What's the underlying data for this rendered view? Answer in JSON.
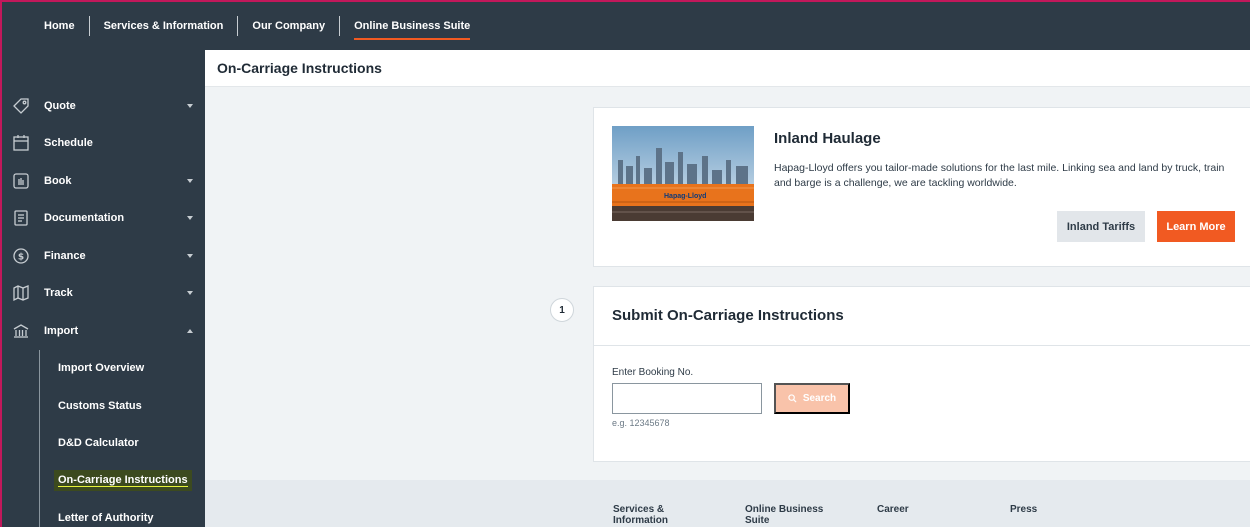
{
  "topnav": {
    "items": [
      {
        "label": "Home"
      },
      {
        "label": "Services & Information"
      },
      {
        "label": "Our Company"
      },
      {
        "label": "Online Business Suite"
      }
    ]
  },
  "sidebar": {
    "items": [
      {
        "label": "Quote",
        "icon": "tag-icon",
        "expandable": true
      },
      {
        "label": "Schedule",
        "icon": "calendar-icon",
        "expandable": false
      },
      {
        "label": "Book",
        "icon": "hand-icon",
        "expandable": true
      },
      {
        "label": "Documentation",
        "icon": "document-icon",
        "expandable": true
      },
      {
        "label": "Finance",
        "icon": "dollar-icon",
        "expandable": true
      },
      {
        "label": "Track",
        "icon": "map-icon",
        "expandable": true
      },
      {
        "label": "Import",
        "icon": "building-icon",
        "expanded": true
      }
    ],
    "import_subitems": [
      {
        "label": "Import Overview"
      },
      {
        "label": "Customs Status"
      },
      {
        "label": "D&D Calculator"
      },
      {
        "label": "On-Carriage Instructions",
        "active": true
      },
      {
        "label": "Letter of Authority"
      }
    ]
  },
  "main": {
    "title": "On-Carriage Instructions"
  },
  "inland": {
    "title": "Inland Haulage",
    "text": "Hapag-Lloyd offers you tailor-made solutions for the last mile. Linking sea and land by truck, train and barge is a challenge, we are tackling worldwide.",
    "btn_tariffs": "Inland Tariffs",
    "btn_learn": "Learn More",
    "image_brand_text": "Hapag-Lloyd"
  },
  "submit": {
    "step_number": "1",
    "title": "Submit On-Carriage Instructions",
    "label": "Enter Booking No.",
    "input_value": "",
    "search_label": "Search",
    "hint": "e.g. 12345678"
  },
  "footer": {
    "columns": [
      "Services & Information",
      "Online Business Suite",
      "Career",
      "Press"
    ]
  },
  "colors": {
    "nav_bg": "#2e3b47",
    "accent": "#f15a22",
    "accent_disabled": "#f9c3aa",
    "content_bg": "#f0f3f5"
  }
}
